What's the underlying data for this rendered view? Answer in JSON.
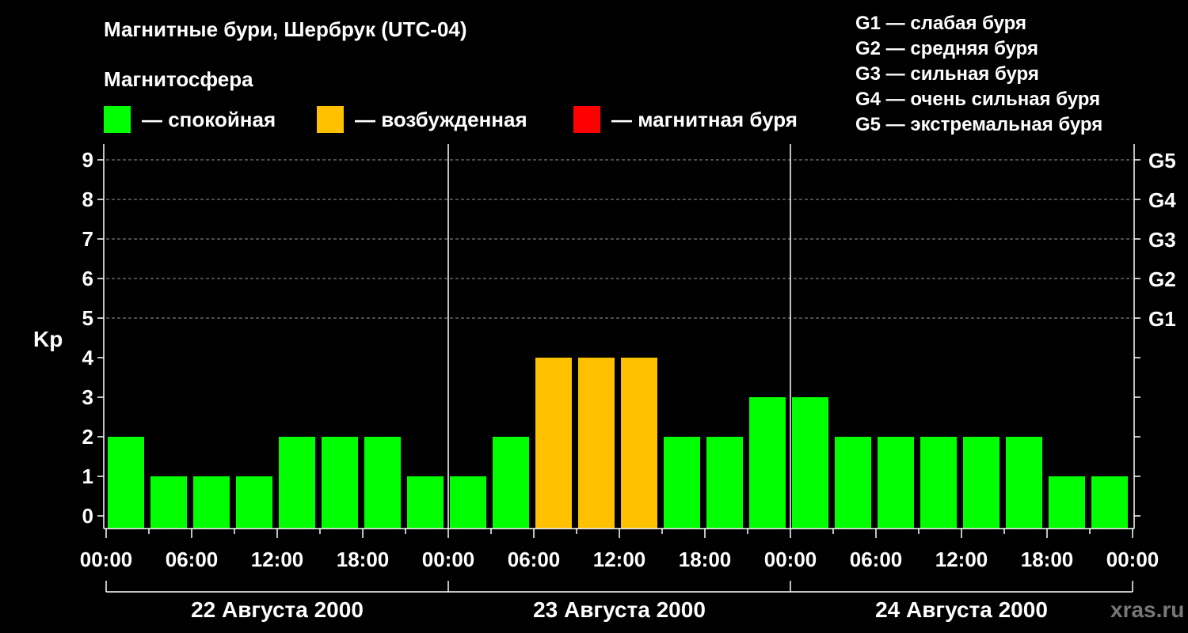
{
  "header": {
    "title": "Магнитные бури, Шербрук (UTC-04)",
    "subtitle": "Магнитосфера"
  },
  "legend": [
    {
      "label": "— спокойная",
      "color": "#00ff00"
    },
    {
      "label": "— возбужденная",
      "color": "#ffc000"
    },
    {
      "label": "— магнитная буря",
      "color": "#ff0000"
    }
  ],
  "g_legend": [
    "G1 — слабая буря",
    "G2 — средняя буря",
    "G3 — сильная буря",
    "G4 — очень сильная буря",
    "G5 — экстремальная буря"
  ],
  "watermark": "xras.ru",
  "chart_data": {
    "type": "bar",
    "ylabel": "Kp",
    "ylim": [
      0,
      9
    ],
    "yticks": [
      "0",
      "1",
      "2",
      "3",
      "4",
      "5",
      "6",
      "7",
      "8",
      "9"
    ],
    "right_ticks": [
      {
        "kp": 5,
        "label": "G1"
      },
      {
        "kp": 6,
        "label": "G2"
      },
      {
        "kp": 7,
        "label": "G3"
      },
      {
        "kp": 8,
        "label": "G4"
      },
      {
        "kp": 9,
        "label": "G5"
      }
    ],
    "grid_levels": [
      5,
      6,
      7,
      8,
      9
    ],
    "x_tick_labels": [
      "00:00",
      "06:00",
      "12:00",
      "18:00",
      "00:00",
      "06:00",
      "12:00",
      "18:00",
      "00:00",
      "06:00",
      "12:00",
      "18:00",
      "00:00"
    ],
    "days": [
      "22 Августа 2000",
      "23 Августа 2000",
      "24 Августа 2000"
    ],
    "interval_hours": 3,
    "thresholds": {
      "excited_from": 4,
      "storm_from": 5
    },
    "values": [
      2,
      1,
      1,
      1,
      2,
      2,
      2,
      1,
      1,
      2,
      4,
      4,
      4,
      2,
      2,
      3,
      3,
      2,
      2,
      2,
      2,
      2,
      1,
      1
    ],
    "colors": {
      "quiet": "#00ff00",
      "excited": "#ffc000",
      "storm": "#ff0000",
      "grid": "#999999",
      "axis": "#ffffff"
    }
  }
}
